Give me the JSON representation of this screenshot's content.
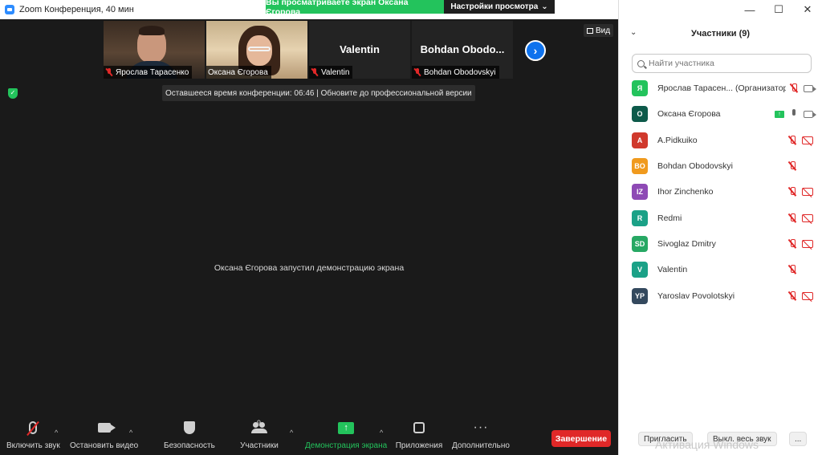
{
  "window": {
    "title": "Zoom Конференция, 40 мин"
  },
  "banner": {
    "viewing_text": "Вы просматриваете экран Оксана Єгорова",
    "view_settings": "Настройки просмотра",
    "view_settings_caret": "⌄"
  },
  "video_strip": {
    "tiles": [
      {
        "name": "Ярослав Тарасенко"
      },
      {
        "name": "Оксана Єгорова"
      },
      {
        "name": "Valentin",
        "big_name": "Valentin"
      },
      {
        "name": "Bohdan Obodovskyi",
        "big_name": "Bohdan Obodo..."
      }
    ],
    "next_arrow": "›",
    "view_button": "Вид"
  },
  "remaining_time": "Оставшееся время конференции: 06:46 | Обновите до профессиональной версии",
  "sharing_message": "Оксана Єгорова запустил демонстрацию экрана",
  "toolbar": {
    "unmute": "Включить звук",
    "stop_video": "Остановить видео",
    "security": "Безопасность",
    "participants": "Участники",
    "participants_count": "9",
    "share_screen": "Демонстрация экрана",
    "apps": "Приложения",
    "more": "Дополнительно",
    "end": "Завершение",
    "caret": "^",
    "share_arrow": "↑",
    "more_dots": "···"
  },
  "window_controls": {
    "minimize": "—",
    "maximize": "☐",
    "close": "✕"
  },
  "panel": {
    "collapse": "⌄",
    "title": "Участники (9)",
    "search_placeholder": "Найти участника",
    "participants": [
      {
        "initials": "Я",
        "name": "Ярослав Тарасен... (Организатор, я)",
        "color": "#23c35c",
        "mic": "muted",
        "video": "on",
        "share": false
      },
      {
        "initials": "О",
        "name": "Оксана Єгорова",
        "color": "#0d5a4a",
        "mic": "on",
        "video": "on",
        "share": true
      },
      {
        "initials": "A",
        "name": "A.Pidkuiko",
        "color": "#d0392c",
        "mic": "muted",
        "video": "off",
        "share": false
      },
      {
        "initials": "BO",
        "name": "Bohdan Obodovskyi",
        "color": "#f09a1e",
        "mic": "muted",
        "video": "none",
        "share": false
      },
      {
        "initials": "IZ",
        "name": "Ihor Zinchenko",
        "color": "#8e4ab5",
        "mic": "muted",
        "video": "off",
        "share": false
      },
      {
        "initials": "R",
        "name": "Redmi",
        "color": "#1ba187",
        "mic": "muted",
        "video": "off",
        "share": false
      },
      {
        "initials": "SD",
        "name": "Sivoglaz Dmitry",
        "color": "#27a864",
        "mic": "muted",
        "video": "off",
        "share": false
      },
      {
        "initials": "V",
        "name": "Valentin",
        "color": "#1ba187",
        "mic": "muted",
        "video": "none",
        "share": false
      },
      {
        "initials": "YP",
        "name": "Yaroslav Povolotskyi",
        "color": "#34495e",
        "mic": "muted",
        "video": "off",
        "share": false
      }
    ],
    "footer": {
      "invite": "Пригласить",
      "mute_all": "Выкл. весь звук",
      "more": "..."
    },
    "watermark": "Активация Windows"
  },
  "colors": {
    "accent_green": "#23c35c",
    "end_red": "#e02828",
    "link_blue": "#0e72ed"
  }
}
